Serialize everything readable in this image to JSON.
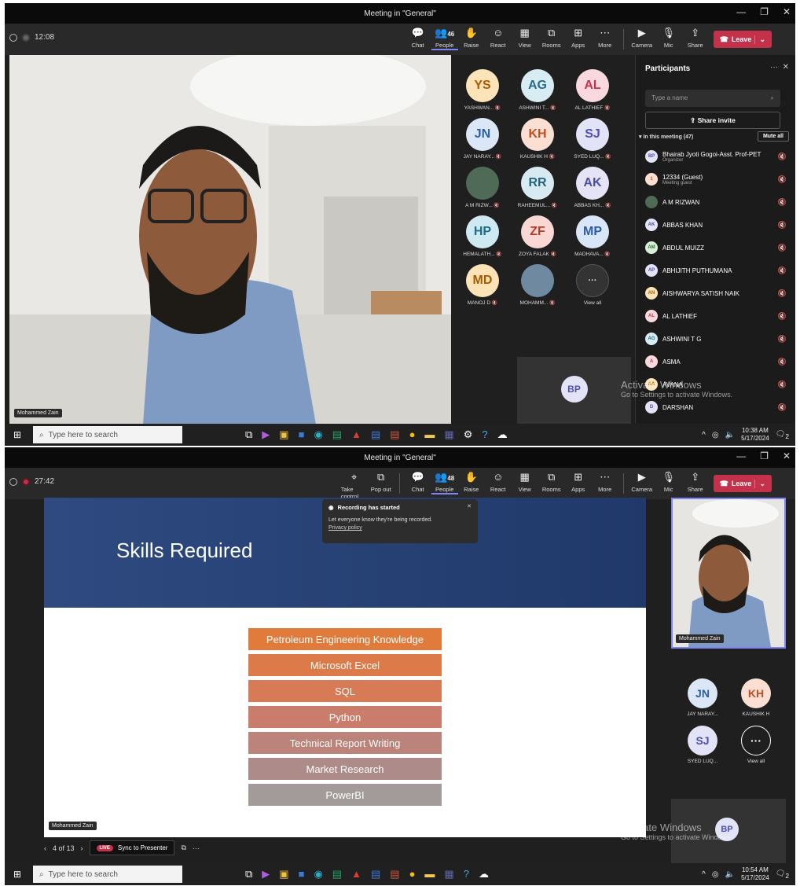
{
  "shot1": {
    "window_title": "Meeting in \"General\"",
    "timer": "12:08",
    "toolbar": [
      {
        "label": "Chat",
        "icon": "chat-icon",
        "glyph": "💬"
      },
      {
        "label": "People",
        "icon": "people-icon",
        "glyph": "👥",
        "count": "46"
      },
      {
        "label": "Raise",
        "icon": "raise-hand-icon",
        "glyph": "✋"
      },
      {
        "label": "React",
        "icon": "react-icon",
        "glyph": "☺"
      },
      {
        "label": "View",
        "icon": "view-icon",
        "glyph": "▦"
      },
      {
        "label": "Rooms",
        "icon": "rooms-icon",
        "glyph": "⧉"
      },
      {
        "label": "Apps",
        "icon": "apps-icon",
        "glyph": "⊞"
      },
      {
        "label": "More",
        "icon": "more-icon",
        "glyph": "⋯"
      },
      {
        "label": "Camera",
        "icon": "camera-icon",
        "glyph": "▶"
      },
      {
        "label": "Mic",
        "icon": "mic-icon",
        "glyph": "🎙"
      },
      {
        "label": "Share",
        "icon": "share-icon",
        "glyph": "⇪"
      }
    ],
    "leave_label": "Leave",
    "main_video_name": "Mohammed Zain",
    "grid": [
      {
        "initials": "YS",
        "name": "YASHWAN...",
        "bg": "#fde4b8",
        "fg": "#b05a00"
      },
      {
        "initials": "AG",
        "name": "ASHWINI T...",
        "bg": "#d8ecf4",
        "fg": "#2a6b8a"
      },
      {
        "initials": "AL",
        "name": "AL LATHIEF",
        "bg": "#f9d9de",
        "fg": "#c23450"
      },
      {
        "initials": "JN",
        "name": "JAY NARAY...",
        "bg": "#dbe7f7",
        "fg": "#2b5fa8"
      },
      {
        "initials": "KH",
        "name": "KAUSHIK H",
        "bg": "#fbdfd3",
        "fg": "#c24f22"
      },
      {
        "initials": "SJ",
        "name": "SYED LUQ...",
        "bg": "#e3e3f8",
        "fg": "#4f4fb0"
      },
      {
        "initials": "",
        "name": "A M RIZW...",
        "bg": "#4f6b57",
        "fg": "#fff",
        "photo": true
      },
      {
        "initials": "RR",
        "name": "RAHEEMUL...",
        "bg": "#d7eaf2",
        "fg": "#25647f"
      },
      {
        "initials": "AK",
        "name": "ABBAS KH...",
        "bg": "#e4e4f6",
        "fg": "#4d4ea7"
      },
      {
        "initials": "HP",
        "name": "HEMALATH...",
        "bg": "#cfe9f3",
        "fg": "#1e6b86"
      },
      {
        "initials": "ZF",
        "name": "ZOYA FALAK",
        "bg": "#f9d7d3",
        "fg": "#b53a2b"
      },
      {
        "initials": "MP",
        "name": "MADHAVA...",
        "bg": "#d9e6f8",
        "fg": "#2a5ca5"
      },
      {
        "initials": "MD",
        "name": "MANOJ D",
        "bg": "#fde3b6",
        "fg": "#a55a00"
      },
      {
        "initials": "",
        "name": "MOHAMM...",
        "bg": "#6f8aa0",
        "fg": "#fff",
        "photo": true
      },
      {
        "initials": "···",
        "name": "View all",
        "bg": "#333",
        "fg": "#ddd",
        "more": true
      }
    ],
    "self_tile_initials": "BP",
    "participants": {
      "title": "Participants",
      "search_placeholder": "Type a name",
      "share_invite": "Share invite",
      "in_meeting": "In this meeting (47)",
      "mute_all": "Mute all",
      "list": [
        {
          "initials": "BP",
          "name": "Bhairab Jyoti Gogoi-Asst. Prof-PET",
          "sub": "Organizer",
          "bg": "#e3e3f8",
          "fg": "#4f4fb0"
        },
        {
          "initials": "1",
          "name": "12334 (Guest)",
          "sub": "Meeting guest",
          "bg": "#fbdfd3",
          "fg": "#c24f22"
        },
        {
          "initials": "",
          "name": "A M RIZWAN",
          "sub": "",
          "bg": "#4f6b57",
          "fg": "#fff",
          "photo": true
        },
        {
          "initials": "AK",
          "name": "ABBAS KHAN",
          "sub": "",
          "bg": "#e4e4f6",
          "fg": "#4d4ea7"
        },
        {
          "initials": "AM",
          "name": "ABDUL MUIZZ",
          "sub": "",
          "bg": "#d9efd9",
          "fg": "#2d7a2d"
        },
        {
          "initials": "AP",
          "name": "ABHIJITH PUTHUMANA",
          "sub": "",
          "bg": "#e3e3f8",
          "fg": "#4f4fb0"
        },
        {
          "initials": "AN",
          "name": "AISHWARYA SATISH NAIK",
          "sub": "",
          "bg": "#fde4b8",
          "fg": "#b05a00"
        },
        {
          "initials": "AL",
          "name": "AL LATHIEF",
          "sub": "",
          "bg": "#f9d9de",
          "fg": "#c23450"
        },
        {
          "initials": "AG",
          "name": "ASHWINI T G",
          "sub": "",
          "bg": "#d8ecf4",
          "fg": "#2a6b8a"
        },
        {
          "initials": "A",
          "name": "ASMA",
          "sub": "",
          "bg": "#f9d9de",
          "fg": "#c23450"
        },
        {
          "initials": "AA",
          "name": "AVANA",
          "sub": "",
          "bg": "#fde4b8",
          "fg": "#b05a00"
        },
        {
          "initials": "D",
          "name": "DARSHAN",
          "sub": "",
          "bg": "#e3e3f8",
          "fg": "#4f4fb0"
        }
      ]
    },
    "watermark_line1": "Activate Windows",
    "watermark_line2": "Go to Settings to activate Windows.",
    "taskbar": {
      "search": "Type here to search",
      "time": "10:38 AM",
      "date": "5/17/2024",
      "notif": "2"
    }
  },
  "shot2": {
    "window_title": "Meeting in \"General\"",
    "timer": "27:42",
    "toolbar_extra": [
      {
        "label": "Take control",
        "icon": "take-control-icon",
        "glyph": "⌖"
      },
      {
        "label": "Pop out",
        "icon": "pop-out-icon",
        "glyph": "⧉"
      }
    ],
    "toolbar": [
      {
        "label": "Chat",
        "icon": "chat-icon",
        "glyph": "💬"
      },
      {
        "label": "People",
        "icon": "people-icon",
        "glyph": "👥",
        "count": "48"
      },
      {
        "label": "Raise",
        "icon": "raise-hand-icon",
        "glyph": "✋"
      },
      {
        "label": "React",
        "icon": "react-icon",
        "glyph": "☺"
      },
      {
        "label": "View",
        "icon": "view-icon",
        "glyph": "▦"
      },
      {
        "label": "Rooms",
        "icon": "rooms-icon",
        "glyph": "⧉"
      },
      {
        "label": "Apps",
        "icon": "apps-icon",
        "glyph": "⊞"
      },
      {
        "label": "More",
        "icon": "more-icon",
        "glyph": "⋯"
      },
      {
        "label": "Camera",
        "icon": "camera-icon",
        "glyph": "▶"
      },
      {
        "label": "Mic",
        "icon": "mic-icon",
        "glyph": "🎙"
      },
      {
        "label": "Share",
        "icon": "share-icon",
        "glyph": "⇪"
      }
    ],
    "leave_label": "Leave",
    "toast": {
      "title": "Recording has started",
      "body": "Let everyone know they're being recorded.",
      "link": "Privacy policy"
    },
    "slide": {
      "title": "Skills Required",
      "skills": [
        {
          "label": "Petroleum Engineering Knowledge",
          "color": "#e07b3c"
        },
        {
          "label": "Microsoft Excel",
          "color": "#dc7b49"
        },
        {
          "label": "SQL",
          "color": "#d77b57"
        },
        {
          "label": "Python",
          "color": "#c97d6a"
        },
        {
          "label": "Technical Report Writing",
          "color": "#bb8379"
        },
        {
          "label": "Market Research",
          "color": "#ad8b89"
        },
        {
          "label": "PowerBI",
          "color": "#a39a9a"
        }
      ]
    },
    "presenter_name": "Mohammed Zain",
    "slide_nav": {
      "page": "4 of 13",
      "live": "LIVE",
      "sync": "Sync to Presenter"
    },
    "side_tiles": [
      {
        "initials": "JN",
        "name": "JAY NARAY...",
        "bg": "#dbe7f7",
        "fg": "#2b5fa8"
      },
      {
        "initials": "KH",
        "name": "KAUSHIK H",
        "bg": "#fbdfd3",
        "fg": "#c24f22"
      },
      {
        "initials": "SJ",
        "name": "SYED LUQ...",
        "bg": "#e3e3f8",
        "fg": "#4f4fb0"
      },
      {
        "initials": "···",
        "name": "View all",
        "bg": "#1f1f1f",
        "fg": "#fff",
        "more": true
      }
    ],
    "self_tile_initials": "BP",
    "watermark_line1": "Activate Windows",
    "watermark_line2": "Go to Settings to activate Windows.",
    "taskbar": {
      "search": "Type here to search",
      "time": "10:54 AM",
      "date": "5/17/2024",
      "notif": "2"
    }
  }
}
